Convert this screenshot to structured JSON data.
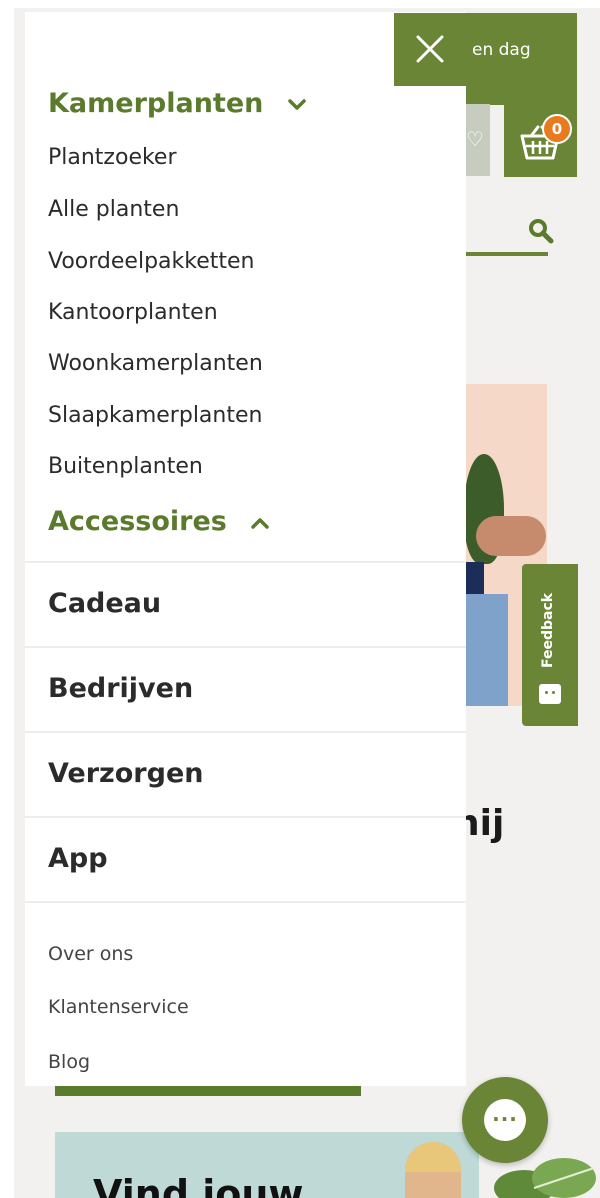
{
  "background_page": {
    "top_banner_text": "en dag",
    "cart_count": "0",
    "hero_partial_text": "nij",
    "promo_text": "Vind jouw",
    "feedback_label": "Feedback"
  },
  "drawer": {
    "categories": [
      {
        "label": "Kamerplanten",
        "expanded": true
      },
      {
        "label": "Accessoires",
        "expanded": false
      }
    ],
    "kamerplanten_items": [
      "Plantzoeker",
      "Alle planten",
      "Voordeelpakketten",
      "Kantoorplanten",
      "Woonkamerplanten",
      "Slaapkamerplanten",
      "Buitenplanten"
    ],
    "main_items": [
      "Cadeau",
      "Bedrijven",
      "Verzorgen",
      "App"
    ],
    "footer_links": [
      "Over ons",
      "Klantenservice",
      "Blog"
    ]
  },
  "colors": {
    "brand_green": "#6a8536",
    "heading_green": "#5a7a2c",
    "badge_orange": "#ea7a1e"
  },
  "icons": [
    "close-icon",
    "chevron-down-icon",
    "chevron-up-icon",
    "cart-icon",
    "search-icon",
    "heart-icon",
    "chat-icon",
    "feedback-icon"
  ]
}
